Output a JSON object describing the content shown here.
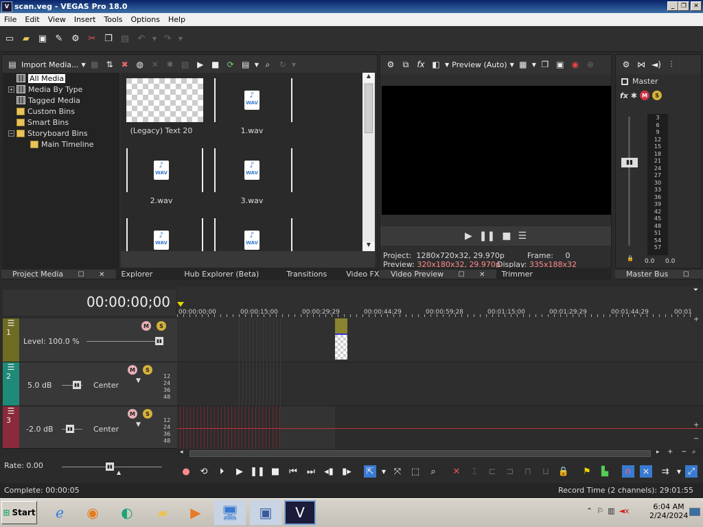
{
  "window": {
    "title": "scan.veg - VEGAS Pro 18.0",
    "icon": "vegas-icon",
    "buttons": [
      "_",
      "❐",
      "✕"
    ]
  },
  "menu": [
    "File",
    "Edit",
    "View",
    "Insert",
    "Tools",
    "Options",
    "Help"
  ],
  "main_toolbar_icons": [
    "new-icon",
    "open-icon",
    "save-icon",
    "save-as-icon",
    "settings-icon",
    "cut-icon",
    "copy-icon",
    "paste-icon",
    "undo-icon",
    "redo-icon"
  ],
  "project_media": {
    "import_label": "Import Media...",
    "tree": [
      {
        "label": "All Media",
        "selected": true
      },
      {
        "label": "Media By Type",
        "expandable": true
      },
      {
        "label": "Tagged Media"
      },
      {
        "label": "Custom Bins"
      },
      {
        "label": "Smart Bins"
      },
      {
        "label": "Storyboard Bins",
        "expandable": true
      },
      {
        "label": "Main Timeline",
        "child": true
      }
    ],
    "items": [
      "(Legacy) Text 20",
      "1.wav",
      "2.wav",
      "3.wav",
      "",
      ""
    ],
    "wav_tag": "WAV"
  },
  "left_tabs": [
    "Project Media",
    "Explorer",
    "Hub Explorer (Beta)",
    "Transitions",
    "Video FX"
  ],
  "preview": {
    "mode": "Preview (Auto)",
    "project_label": "Project:",
    "project_value": "1280x720x32, 29.970p",
    "frame_label": "Frame:",
    "frame_value": "0",
    "preview_label": "Preview:",
    "preview_value": "320x180x32, 29.970p",
    "display_label": "Display:",
    "display_value": "335x188x32",
    "tabs": [
      "Video Preview",
      "Trimmer"
    ]
  },
  "master": {
    "title": "Master",
    "scale": [
      "3",
      "6",
      "9",
      "12",
      "15",
      "18",
      "21",
      "24",
      "27",
      "30",
      "33",
      "36",
      "39",
      "42",
      "45",
      "48",
      "51",
      "54",
      "57"
    ],
    "left_value": "0.0",
    "right_value": "0.0",
    "tab": "Master Bus"
  },
  "timeline": {
    "timecode": "00:00:00;00",
    "ruler": [
      "00:00:00;00",
      "00:00:15;00",
      "00:00:29;29",
      "00:00:44;29",
      "00:00:59;28",
      "00:01:15;00",
      "00:01:29;29",
      "00:01:44;29",
      "00:01"
    ],
    "tracks": [
      {
        "num": "1",
        "level": "Level: 100.0 %",
        "color": "#6e6b22"
      },
      {
        "num": "2",
        "level": "5.0 dB",
        "pan": "Center",
        "color": "#1f8a78"
      },
      {
        "num": "3",
        "level": "-2.0 dB",
        "pan": "Center",
        "color": "#8a2a3a"
      }
    ],
    "meter": [
      "12",
      "24",
      "36",
      "48"
    ],
    "rate": "Rate: 0.00"
  },
  "status": {
    "left": "Complete: 00:00:05",
    "right": "Record Time (2 channels): 29:01:55"
  },
  "taskbar": {
    "start": "Start",
    "time": "6:04 AM",
    "date": "2/24/2024"
  }
}
